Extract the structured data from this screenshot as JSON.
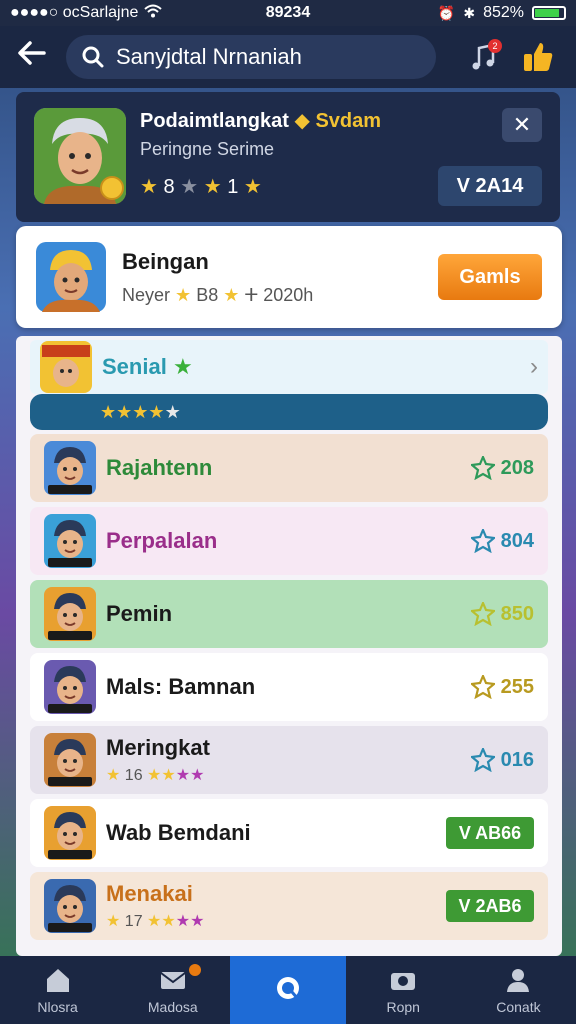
{
  "status": {
    "carrier": "●●●●○ ocSarlajne",
    "time": "89234",
    "battery": "852%",
    "battery_level": 0.85
  },
  "header": {
    "back_icon": "arrow-left-icon",
    "search_text": "Sanyjdtal Nrnaniah",
    "music_badge": "2"
  },
  "profile": {
    "name_part1": "Podaimtlangkat",
    "name_part2": "Svdam",
    "subtitle": "Peringne Serime",
    "rating_a": "8",
    "rating_b": "1",
    "version": "V 2A14"
  },
  "featured": {
    "title": "Beingan",
    "meta_a": "Neyer",
    "meta_b": "B8",
    "meta_c": "2020h",
    "button": "Gamls"
  },
  "section": {
    "label": "Senial",
    "star_count": 4
  },
  "rows": [
    {
      "name": "Rajahtenn",
      "score": "208",
      "color": "#2e8a3a",
      "bg": "#f2e0d2",
      "badge": "#2e9a5a"
    },
    {
      "name": "Perpalalan",
      "score": "804",
      "color": "#9a2e8a",
      "bg": "#f7e8f4",
      "badge": "#2a8ab0"
    },
    {
      "name": "Pemin",
      "score": "850",
      "color": "#1a1a1a",
      "bg": "#b2e0b8",
      "badge": "#b8c030"
    },
    {
      "name": "Mals: Bamnan",
      "score": "255",
      "color": "#1a1a1a",
      "bg": "#ffffff",
      "badge": "#b89a20"
    },
    {
      "name": "Meringkat",
      "stars": "16",
      "score": "016",
      "color": "#1a1a1a",
      "bg": "#e6e2ec",
      "badge": "#2a8ab0"
    },
    {
      "name": "Wab Bemdani",
      "pill": "V AB66",
      "color": "#1a1a1a",
      "bg": "#ffffff"
    },
    {
      "name": "Menakai",
      "stars": "17",
      "pill": "V 2AB6",
      "color": "#c8701a",
      "bg": "#f5e6d8"
    }
  ],
  "nav": [
    {
      "label": "Nlosra",
      "icon": "home-icon"
    },
    {
      "label": "Madosa",
      "icon": "mail-icon",
      "badge": true
    },
    {
      "label": "",
      "icon": "search-icon",
      "active": true
    },
    {
      "label": "Ropn",
      "icon": "camera-icon"
    },
    {
      "label": "Conatk",
      "icon": "profile-icon"
    }
  ]
}
